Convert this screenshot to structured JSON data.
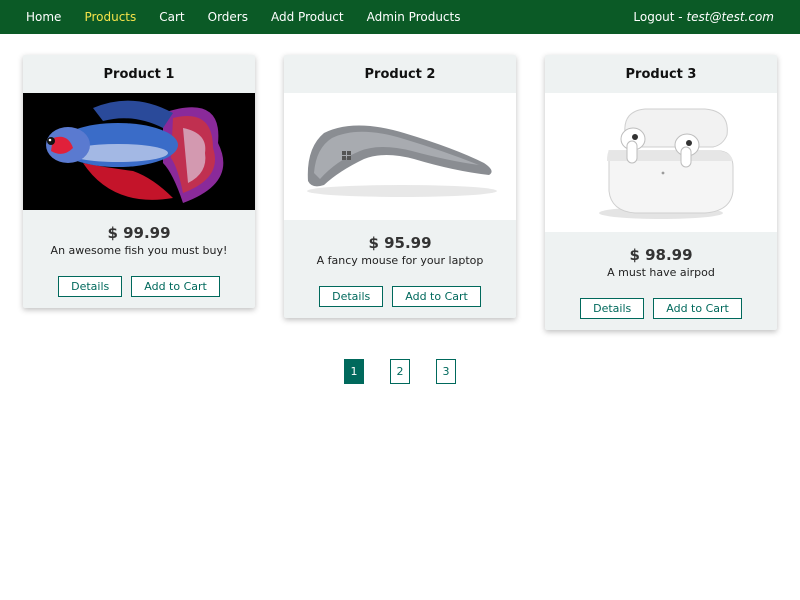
{
  "nav": {
    "items": [
      {
        "label": "Home",
        "active": false
      },
      {
        "label": "Products",
        "active": true
      },
      {
        "label": "Cart",
        "active": false
      },
      {
        "label": "Orders",
        "active": false
      },
      {
        "label": "Add Product",
        "active": false
      },
      {
        "label": "Admin Products",
        "active": false
      }
    ],
    "logout_label": "Logout - ",
    "user_email": "test@test.com"
  },
  "products": [
    {
      "title": "Product 1",
      "price": "$ 99.99",
      "description": "An awesome fish you must buy!",
      "image_icon": "betta-fish-image",
      "details_label": "Details",
      "add_to_cart_label": "Add to Cart"
    },
    {
      "title": "Product 2",
      "price": "$ 95.99",
      "description": "A fancy mouse for your laptop",
      "image_icon": "arc-mouse-image",
      "details_label": "Details",
      "add_to_cart_label": "Add to Cart"
    },
    {
      "title": "Product 3",
      "price": "$ 98.99",
      "description": "A must have airpod",
      "image_icon": "airpods-image",
      "details_label": "Details",
      "add_to_cart_label": "Add to Cart"
    }
  ],
  "pagination": {
    "pages": [
      "1",
      "2",
      "3"
    ],
    "current": "1"
  },
  "colors": {
    "header_bg": "#0b5a26",
    "active_nav": "#f5e34a",
    "accent": "#00695c",
    "card_bg": "#eef2f2"
  }
}
